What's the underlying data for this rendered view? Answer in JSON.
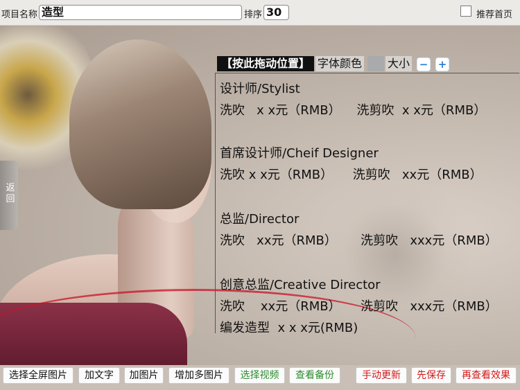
{
  "header": {
    "name_label": "项目名称",
    "name_value": "造型",
    "sort_label": "排序",
    "sort_value": "30",
    "recommend_label": "推荐首页"
  },
  "stage": {
    "back_label": "返回"
  },
  "editor_toolbar": {
    "drag_label": "【按此拖动位置】",
    "font_color_label": "字体颜色",
    "size_label": "大小",
    "minus_label": "−",
    "plus_label": "+"
  },
  "price_text": [
    "设计师/Stylist",
    "洗吹   x x元（RMB）    洗剪吹  x x元（RMB）",
    "首席设计师/Cheif Designer",
    "洗吹 x x元（RMB）     洗剪吹   xx元（RMB）",
    "总监/Director",
    "洗吹   xx元（RMB）      洗剪吹   xxx元（RMB）",
    "创意总监/Creative Director",
    "洗吹    xx元（RMB）     洗剪吹   xxx元（RMB）",
    "编发造型  x x x元(RMB)"
  ],
  "bottom_buttons": [
    {
      "label": "选择全屏图片",
      "color": "#111111"
    },
    {
      "label": "加文字",
      "color": "#111111"
    },
    {
      "label": "加图片",
      "color": "#111111"
    },
    {
      "label": "增加多图片",
      "color": "#111111"
    },
    {
      "label": "选择视频",
      "color": "#2e8b2e"
    },
    {
      "label": "查看备份",
      "color": "#2e8b2e"
    },
    {
      "label": "手动更新",
      "color": "#d01919"
    },
    {
      "label": "先保存",
      "color": "#d01919"
    },
    {
      "label": "再查看效果",
      "color": "#d01919"
    }
  ]
}
